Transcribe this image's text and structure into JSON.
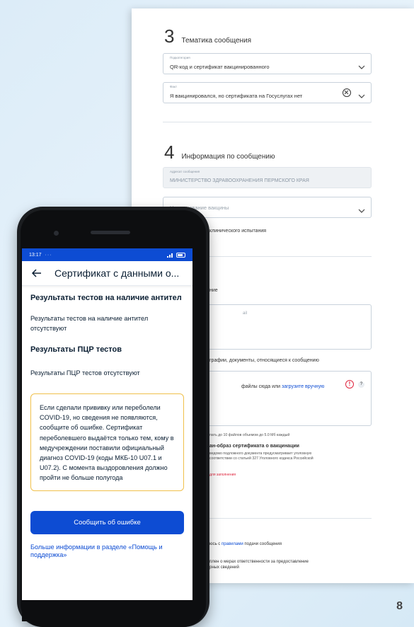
{
  "form": {
    "section3": {
      "number": "3",
      "title": "Тематика сообщения"
    },
    "subcategory": {
      "label": "Подкатегория",
      "value": "QR-код и сертификат вакцинированного"
    },
    "fact": {
      "label": "Факт",
      "value": "Я вакцинировался, но сертификата на Госуслугах нет"
    },
    "section4": {
      "number": "4",
      "title": "Информация по сообщению"
    },
    "recipient": {
      "label": "Адресат сообщения",
      "value": "МИНИСТЕРСТВО ЗДРАВООХРАНЕНИЯ ПЕРМСКОГО КРАЯ"
    },
    "vaccine": {
      "placeholder": "Наименование вакцины"
    },
    "clinical_trial": "клинического испытания",
    "description_heading": "ние",
    "textarea_label": "ail",
    "attachments_caption": "графии, документы, относящиеся к сообщению",
    "upload": {
      "prefix": "файлы сюда или ",
      "link": "загрузите вручную",
      "help": "?"
    },
    "limit_note": "пать до 10 файлов объемом до 5.0 Мб каждый",
    "cert_heading": "ан-образ сертификата о вакцинации",
    "cert_note_1": "ведомо подложного документа предусматривает уголовную",
    "cert_note_2": "соответствии со статьей 327 Уголовного кодекса Российской",
    "required_note": "для заполнения",
    "agree_prefix": "юсь с ",
    "agree_link": "правилами",
    "agree_suffix": " подачи сообщения",
    "resp_1": "плен о мерах ответственности за предоставление",
    "resp_2": "рных сведений"
  },
  "phone": {
    "status": {
      "time": "13:17",
      "dots": "···"
    },
    "appbar": {
      "title": "Сертификат с данными о..."
    },
    "antibody": {
      "heading": "Результаты тестов на наличие антител",
      "text": "Результаты тестов на наличие антител отсутствуют"
    },
    "pcr": {
      "heading": "Результаты ПЦР тестов",
      "text": "Результаты ПЦР тестов отсутствуют"
    },
    "notice": "Если сделали прививку или переболели COVID-19, но сведения не появляются, сообщите об ошибке. Сертификат переболевшего выдаётся только тем, кому в медучреждении поставили официальный диагноз COVID-19 (коды МКБ-10 U07.1 и U07.2). С момента выздоровления должно пройти не больше полугода",
    "report_button": "Сообщить об ошибке",
    "more_link": "Больше информации в разделе «Помощь и поддержка»"
  },
  "page_number": "8",
  "colors": {
    "primary": "#0d4cd3",
    "notice_border": "#f0c04b",
    "error": "#e0263e"
  }
}
